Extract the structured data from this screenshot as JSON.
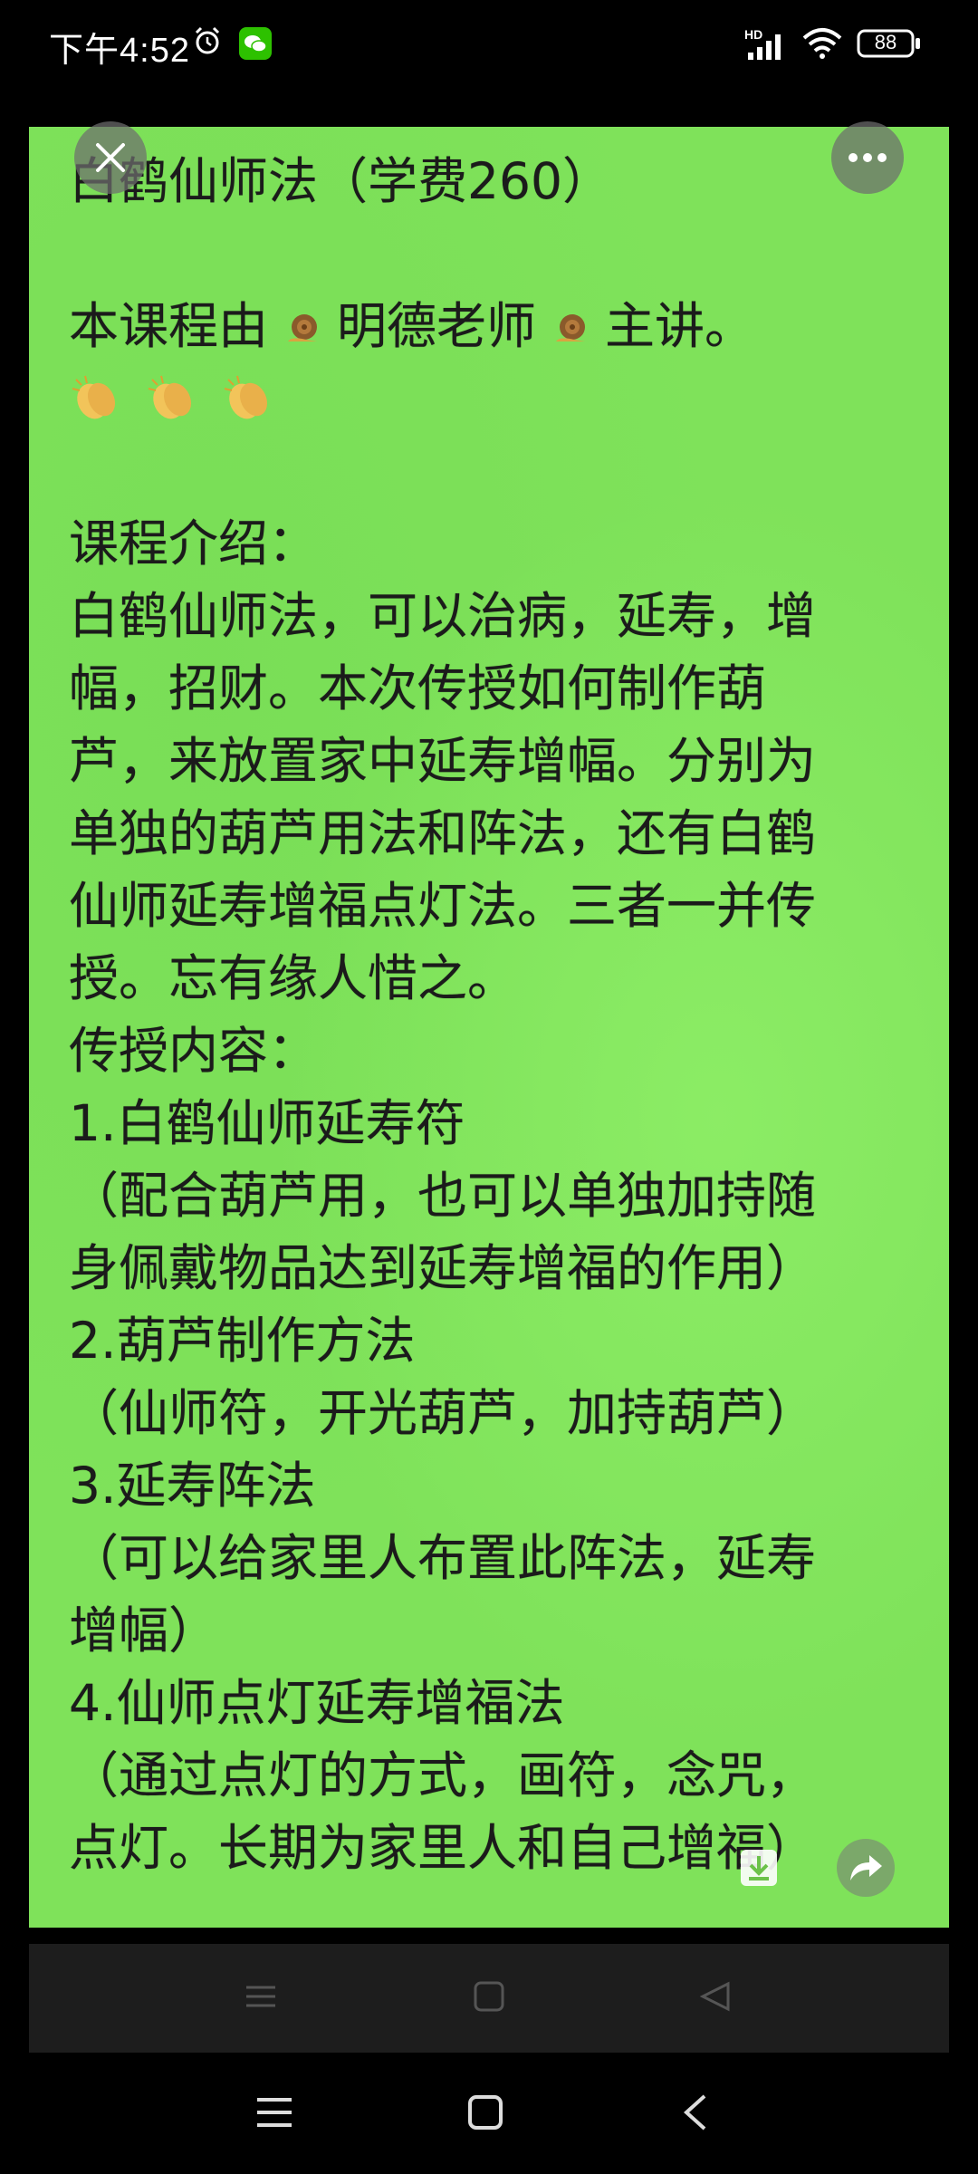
{
  "status_bar": {
    "time": "下午4:52",
    "network_badge": "HD",
    "battery": "88",
    "icons": [
      "alarm-icon",
      "wechat-icon",
      "signal-icon",
      "wifi-icon",
      "battery-icon"
    ]
  },
  "post": {
    "background_color": "#7fe25a",
    "title": "白鹤仙师法（学费260）",
    "intro_part1": "本课程由",
    "intro_part2": "明德老师",
    "intro_part3": "主讲。",
    "lines": [
      "课程介绍：",
      "白鹤仙师法，可以治病，延寿，增",
      "幅，招财。本次传授如何制作葫",
      "芦，来放置家中延寿增幅。分别为",
      "单独的葫芦用法和阵法，还有白鹤",
      "仙师延寿增福点灯法。三者一并传",
      "授。忘有缘人惜之。",
      "传授内容：",
      "1.白鹤仙师延寿符",
      "（配合葫芦用，也可以单独加持随",
      "身佩戴物品达到延寿增福的作用）",
      "2.葫芦制作方法",
      "（仙师符，开光葫芦，加持葫芦）",
      "3.延寿阵法",
      "（可以给家里人布置此阵法，延寿",
      "增幅）",
      "4.仙师点灯延寿增福法",
      "（通过点灯的方式，画符，念咒，",
      "点灯。长期为家里人和自己增福）"
    ]
  },
  "overlay": {
    "close_icon": "close-icon",
    "more_icon": "more-icon",
    "download_icon": "download-icon",
    "share_icon": "share-icon"
  },
  "navigation": {
    "buttons": [
      "menu-icon",
      "home-icon",
      "back-icon"
    ]
  }
}
